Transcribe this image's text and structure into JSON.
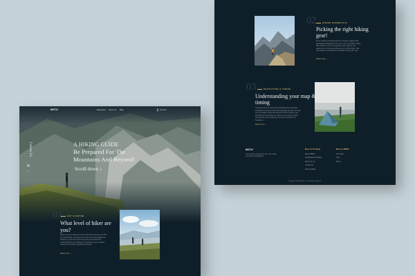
{
  "right_page": {
    "articles": [
      {
        "number": "02",
        "eyebrow": "HIKING ESSENTIALS",
        "title": "Picking the right hiking gear!",
        "body": "From traction-boosting boots to compact rugged tools, lightweight backpacks, and more, your essentials matter. Plan ahead so your kit supports every step of your adventure on the trail and keeps you comfortable, safe and ready for anything the mountain brings your way.",
        "link": "Read more →"
      },
      {
        "number": "03",
        "eyebrow": "NAVIGATION & TIMING",
        "title": "Understanding your map & timing",
        "body": "Knowing where to start and anticipating the changing conditions ensures a safe and enjoyable journey. So take into the details, grasp the elements with a proper map and plan with the future so that you can enjoy a stress-free journey surrounded by your map and where it's headed to.",
        "link": "Read more →"
      }
    ],
    "footer": {
      "brand": "MNTN",
      "text": "Get out there & discover your next slope, mountain & destination!",
      "columns": [
        {
          "heading": "More on The Blog",
          "links": [
            "About MNTN",
            "Contributors & Writers",
            "Write For Us",
            "Contact Us",
            "Privacy Policy"
          ]
        },
        {
          "heading": "More on MNTN",
          "links": [
            "The Team",
            "Jobs",
            "Press"
          ]
        }
      ],
      "copyright": "Copyright 2023 MNTN, Inc. All rights reserved."
    }
  },
  "left_page": {
    "nav": {
      "brand": "MNTN",
      "items": [
        "Equipment",
        "About Us",
        "Blog"
      ],
      "account": "Account"
    },
    "follow_label": "Follow Us",
    "hero": {
      "title_lines": [
        "A HIKING GUIDE",
        "Be Prepared For The",
        "Mountains And Beyond!"
      ],
      "scroll_label": "Scroll down ↓"
    },
    "article": {
      "number": "01",
      "eyebrow": "GET STARTED",
      "title": "What level of hiker are you?",
      "body": "Determine your hiking level for what kind of terrain you will be comfortable. Knowing your limits can be the difference between a great trip and a tough day. We think that understanding your abilities is important so your outdoor experiences remain enjoyable and safe.",
      "link": "Read more →"
    }
  },
  "colors": {
    "page_background": "#c5d2d8",
    "panel_background": "#0f1f29",
    "accent_gold": "#d2b86a",
    "text_light": "#eef2f3"
  }
}
